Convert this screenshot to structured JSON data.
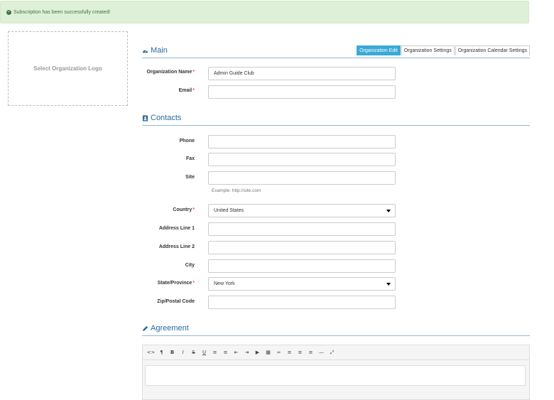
{
  "alert": {
    "icon": "check-circle-icon",
    "text": "Subscription has been successfully created!"
  },
  "logo": {
    "label": "Select Organization Logo"
  },
  "main": {
    "title": "Main",
    "tabs": [
      {
        "label": "Organization Edit",
        "active": true
      },
      {
        "label": "Organization Settings",
        "active": false
      },
      {
        "label": "Organization Calendar Settings",
        "active": false
      }
    ],
    "org_name_label": "Organization Name",
    "org_name_value": "Admin Guide Club",
    "email_label": "Email",
    "email_value": ""
  },
  "contacts": {
    "title": "Contacts",
    "phone_label": "Phone",
    "fax_label": "Fax",
    "site_label": "Site",
    "site_hint": "Example: http://site.com",
    "country_label": "Country",
    "country_value": "United States",
    "address1_label": "Address Line 1",
    "address2_label": "Address Line 2",
    "city_label": "City",
    "state_label": "State/Province",
    "state_value": "New York",
    "zip_label": "Zip/Postal Code"
  },
  "agreement": {
    "title": "Agreement",
    "toolbar": [
      {
        "icon": "code-icon",
        "glyph": "<>"
      },
      {
        "icon": "paragraph-icon",
        "glyph": "¶"
      },
      {
        "icon": "bold-icon",
        "glyph": "B"
      },
      {
        "icon": "italic-icon",
        "glyph": "I"
      },
      {
        "icon": "strikethrough-icon",
        "glyph": "S"
      },
      {
        "icon": "underline-icon",
        "glyph": "U"
      },
      {
        "icon": "unordered-list-icon",
        "glyph": "≡"
      },
      {
        "icon": "ordered-list-icon",
        "glyph": "≡"
      },
      {
        "icon": "outdent-icon",
        "glyph": "⇤"
      },
      {
        "icon": "indent-icon",
        "glyph": "⇥"
      },
      {
        "icon": "video-icon",
        "glyph": "▶"
      },
      {
        "icon": "table-icon",
        "glyph": "▦"
      },
      {
        "icon": "link-icon",
        "glyph": "∞"
      },
      {
        "icon": "align-left-icon",
        "glyph": "≡"
      },
      {
        "icon": "align-center-icon",
        "glyph": "≡"
      },
      {
        "icon": "align-right-icon",
        "glyph": "≡"
      },
      {
        "icon": "horizontal-rule-icon",
        "glyph": "—"
      },
      {
        "icon": "fullscreen-icon",
        "glyph": "⤢"
      }
    ]
  },
  "colors": {
    "accent": "#3aa9d6",
    "section": "#2a6a9e",
    "success_bg": "#dff0d8",
    "required": "#d9534f"
  }
}
